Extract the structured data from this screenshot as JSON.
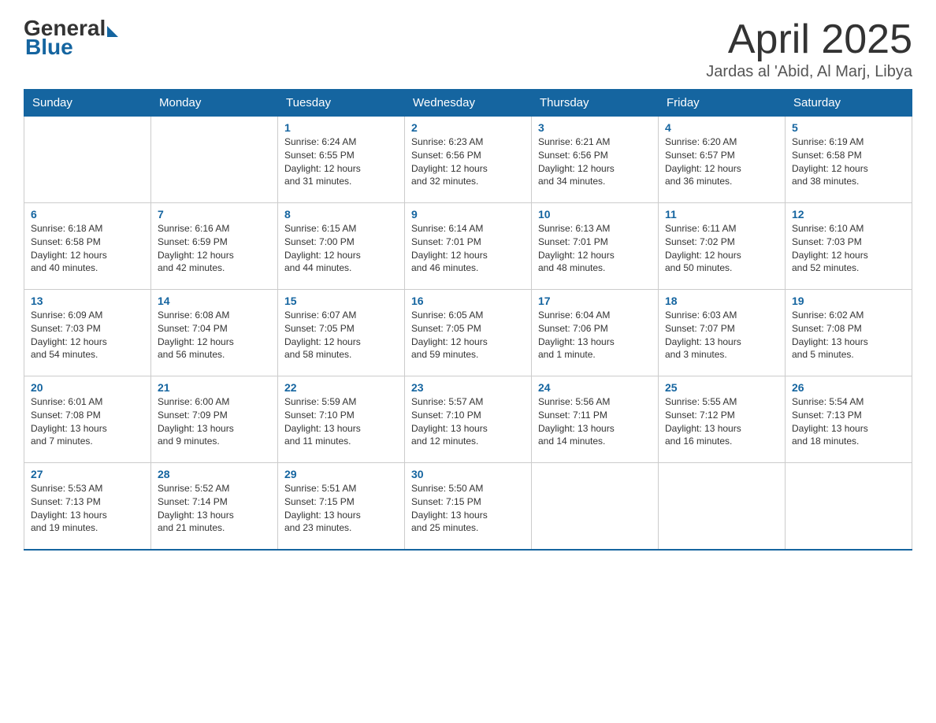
{
  "logo": {
    "general": "General",
    "blue": "Blue"
  },
  "header": {
    "title": "April 2025",
    "subtitle": "Jardas al 'Abid, Al Marj, Libya"
  },
  "days_of_week": [
    "Sunday",
    "Monday",
    "Tuesday",
    "Wednesday",
    "Thursday",
    "Friday",
    "Saturday"
  ],
  "weeks": [
    [
      {
        "day": "",
        "info": ""
      },
      {
        "day": "",
        "info": ""
      },
      {
        "day": "1",
        "info": "Sunrise: 6:24 AM\nSunset: 6:55 PM\nDaylight: 12 hours\nand 31 minutes."
      },
      {
        "day": "2",
        "info": "Sunrise: 6:23 AM\nSunset: 6:56 PM\nDaylight: 12 hours\nand 32 minutes."
      },
      {
        "day": "3",
        "info": "Sunrise: 6:21 AM\nSunset: 6:56 PM\nDaylight: 12 hours\nand 34 minutes."
      },
      {
        "day": "4",
        "info": "Sunrise: 6:20 AM\nSunset: 6:57 PM\nDaylight: 12 hours\nand 36 minutes."
      },
      {
        "day": "5",
        "info": "Sunrise: 6:19 AM\nSunset: 6:58 PM\nDaylight: 12 hours\nand 38 minutes."
      }
    ],
    [
      {
        "day": "6",
        "info": "Sunrise: 6:18 AM\nSunset: 6:58 PM\nDaylight: 12 hours\nand 40 minutes."
      },
      {
        "day": "7",
        "info": "Sunrise: 6:16 AM\nSunset: 6:59 PM\nDaylight: 12 hours\nand 42 minutes."
      },
      {
        "day": "8",
        "info": "Sunrise: 6:15 AM\nSunset: 7:00 PM\nDaylight: 12 hours\nand 44 minutes."
      },
      {
        "day": "9",
        "info": "Sunrise: 6:14 AM\nSunset: 7:01 PM\nDaylight: 12 hours\nand 46 minutes."
      },
      {
        "day": "10",
        "info": "Sunrise: 6:13 AM\nSunset: 7:01 PM\nDaylight: 12 hours\nand 48 minutes."
      },
      {
        "day": "11",
        "info": "Sunrise: 6:11 AM\nSunset: 7:02 PM\nDaylight: 12 hours\nand 50 minutes."
      },
      {
        "day": "12",
        "info": "Sunrise: 6:10 AM\nSunset: 7:03 PM\nDaylight: 12 hours\nand 52 minutes."
      }
    ],
    [
      {
        "day": "13",
        "info": "Sunrise: 6:09 AM\nSunset: 7:03 PM\nDaylight: 12 hours\nand 54 minutes."
      },
      {
        "day": "14",
        "info": "Sunrise: 6:08 AM\nSunset: 7:04 PM\nDaylight: 12 hours\nand 56 minutes."
      },
      {
        "day": "15",
        "info": "Sunrise: 6:07 AM\nSunset: 7:05 PM\nDaylight: 12 hours\nand 58 minutes."
      },
      {
        "day": "16",
        "info": "Sunrise: 6:05 AM\nSunset: 7:05 PM\nDaylight: 12 hours\nand 59 minutes."
      },
      {
        "day": "17",
        "info": "Sunrise: 6:04 AM\nSunset: 7:06 PM\nDaylight: 13 hours\nand 1 minute."
      },
      {
        "day": "18",
        "info": "Sunrise: 6:03 AM\nSunset: 7:07 PM\nDaylight: 13 hours\nand 3 minutes."
      },
      {
        "day": "19",
        "info": "Sunrise: 6:02 AM\nSunset: 7:08 PM\nDaylight: 13 hours\nand 5 minutes."
      }
    ],
    [
      {
        "day": "20",
        "info": "Sunrise: 6:01 AM\nSunset: 7:08 PM\nDaylight: 13 hours\nand 7 minutes."
      },
      {
        "day": "21",
        "info": "Sunrise: 6:00 AM\nSunset: 7:09 PM\nDaylight: 13 hours\nand 9 minutes."
      },
      {
        "day": "22",
        "info": "Sunrise: 5:59 AM\nSunset: 7:10 PM\nDaylight: 13 hours\nand 11 minutes."
      },
      {
        "day": "23",
        "info": "Sunrise: 5:57 AM\nSunset: 7:10 PM\nDaylight: 13 hours\nand 12 minutes."
      },
      {
        "day": "24",
        "info": "Sunrise: 5:56 AM\nSunset: 7:11 PM\nDaylight: 13 hours\nand 14 minutes."
      },
      {
        "day": "25",
        "info": "Sunrise: 5:55 AM\nSunset: 7:12 PM\nDaylight: 13 hours\nand 16 minutes."
      },
      {
        "day": "26",
        "info": "Sunrise: 5:54 AM\nSunset: 7:13 PM\nDaylight: 13 hours\nand 18 minutes."
      }
    ],
    [
      {
        "day": "27",
        "info": "Sunrise: 5:53 AM\nSunset: 7:13 PM\nDaylight: 13 hours\nand 19 minutes."
      },
      {
        "day": "28",
        "info": "Sunrise: 5:52 AM\nSunset: 7:14 PM\nDaylight: 13 hours\nand 21 minutes."
      },
      {
        "day": "29",
        "info": "Sunrise: 5:51 AM\nSunset: 7:15 PM\nDaylight: 13 hours\nand 23 minutes."
      },
      {
        "day": "30",
        "info": "Sunrise: 5:50 AM\nSunset: 7:15 PM\nDaylight: 13 hours\nand 25 minutes."
      },
      {
        "day": "",
        "info": ""
      },
      {
        "day": "",
        "info": ""
      },
      {
        "day": "",
        "info": ""
      }
    ]
  ]
}
